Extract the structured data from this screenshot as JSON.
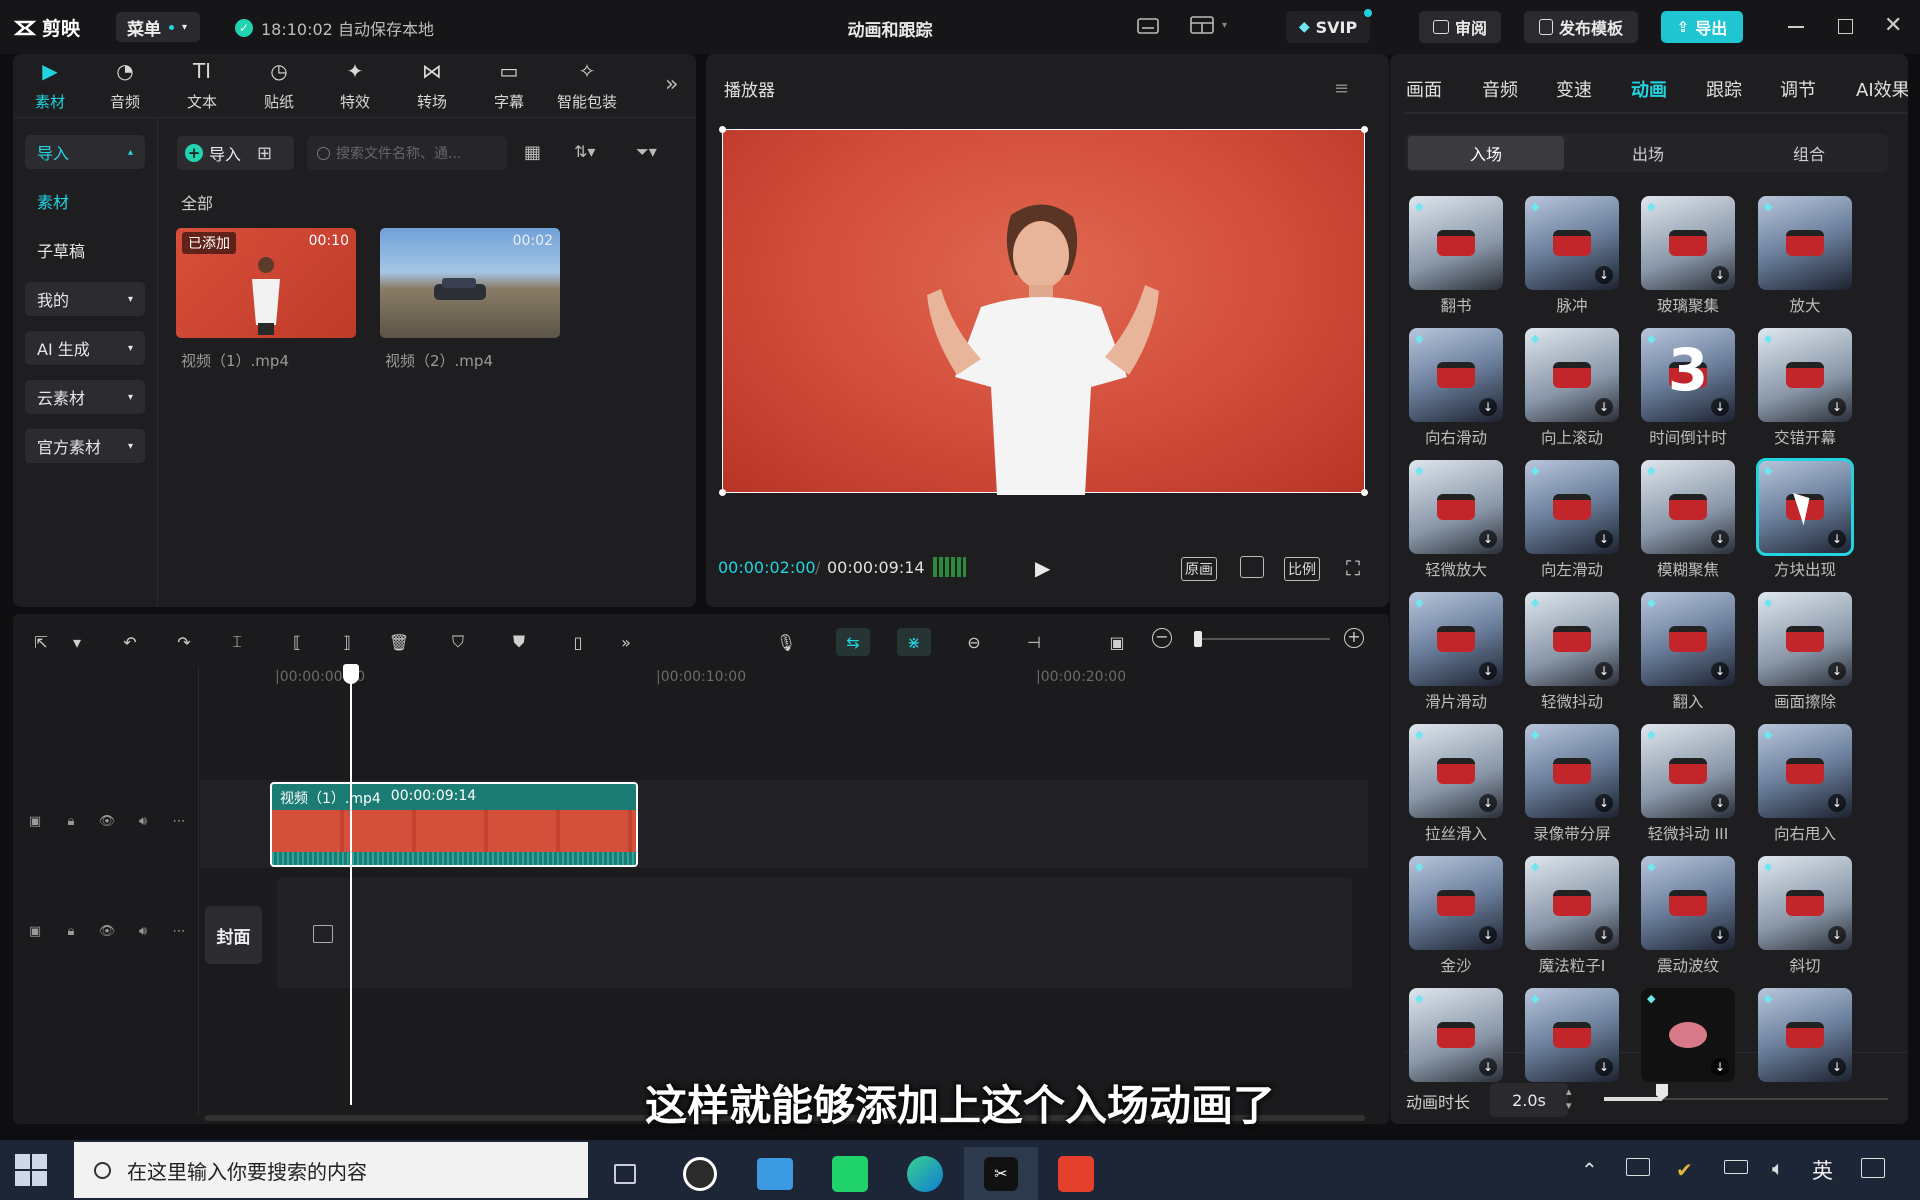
{
  "app": {
    "name": "剪映",
    "menu": "菜单",
    "autosave": "18:10:02 自动保存本地",
    "title": "动画和跟踪",
    "svip": "SVIP",
    "review": "审阅",
    "publish_template": "发布模板",
    "export": "导出"
  },
  "colors": {
    "accent": "#22d3e0",
    "bg": "#0e0e10",
    "panel": "#1e1e21",
    "clip": "#1b7c74",
    "export_btn": "#1fc6d2"
  },
  "toolbar": [
    {
      "label": "素材",
      "icon": "media-icon",
      "active": true
    },
    {
      "label": "音频",
      "icon": "audio-icon"
    },
    {
      "label": "文本",
      "icon": "text-icon"
    },
    {
      "label": "贴纸",
      "icon": "sticker-icon"
    },
    {
      "label": "特效",
      "icon": "effects-icon"
    },
    {
      "label": "转场",
      "icon": "transition-icon"
    },
    {
      "label": "字幕",
      "icon": "subtitle-icon"
    },
    {
      "label": "智能包装",
      "icon": "smart-pack-icon"
    }
  ],
  "sidebar": [
    {
      "label": "导入",
      "chevron": "up",
      "active": true
    },
    {
      "label": "素材",
      "active": true
    },
    {
      "label": "子草稿"
    },
    {
      "label": "我的",
      "chevron": "down"
    },
    {
      "label": "AI 生成",
      "chevron": "down"
    },
    {
      "label": "云素材",
      "chevron": "down"
    },
    {
      "label": "官方素材",
      "chevron": "down"
    }
  ],
  "media": {
    "import_label": "导入",
    "search_placeholder": "搜索文件名称、通...",
    "all_label": "全部",
    "items": [
      {
        "name": "视频（1）.mp4",
        "badge": "已添加",
        "duration": "00:10"
      },
      {
        "name": "视频（2）.mp4",
        "badge": "",
        "duration": "00:02"
      }
    ]
  },
  "player": {
    "title": "播放器",
    "current_time": "00:00:02:00",
    "total_time": "00:00:09:14",
    "btn_original": "原画",
    "btn_ratio": "比例"
  },
  "timeline": {
    "ruler": [
      "|00:00:00:00",
      "|00:00:10:00",
      "|00:00:20:00"
    ],
    "clip_name": "视频（1）.mp4",
    "clip_duration": "00:00:09:14",
    "cover_label": "封面"
  },
  "right": {
    "tabs": [
      "画面",
      "音频",
      "变速",
      "动画",
      "跟踪",
      "调节",
      "AI效果"
    ],
    "active_tab": "动画",
    "subtabs": [
      "入场",
      "出场",
      "组合"
    ],
    "animations": [
      {
        "label": "翻书"
      },
      {
        "label": "脉冲"
      },
      {
        "label": "玻璃聚集"
      },
      {
        "label": "放大"
      },
      {
        "label": "向右滑动"
      },
      {
        "label": "向上滚动"
      },
      {
        "label": "时间倒计时"
      },
      {
        "label": "交错开幕"
      },
      {
        "label": "轻微放大"
      },
      {
        "label": "向左滑动"
      },
      {
        "label": "模糊聚焦"
      },
      {
        "label": "方块出现"
      },
      {
        "label": "滑片滑动"
      },
      {
        "label": "轻微抖动"
      },
      {
        "label": "翻入"
      },
      {
        "label": "画面擦除"
      },
      {
        "label": "拉丝滑入"
      },
      {
        "label": "录像带分屏"
      },
      {
        "label": "轻微抖动 III"
      },
      {
        "label": "向右甩入"
      },
      {
        "label": "金沙"
      },
      {
        "label": "魔法粒子I"
      },
      {
        "label": "震动波纹"
      },
      {
        "label": "斜切"
      },
      {
        "label": ""
      },
      {
        "label": ""
      },
      {
        "label": ""
      },
      {
        "label": ""
      }
    ],
    "selected_animation": "方块出现",
    "countdown_digit": "3",
    "duration_label": "动画时长",
    "duration_value": "2.0s"
  },
  "subtitle_overlay": "这样就能够添加上这个入场动画了",
  "taskbar": {
    "search_placeholder": "在这里输入你要搜索的内容",
    "lang": "英"
  }
}
